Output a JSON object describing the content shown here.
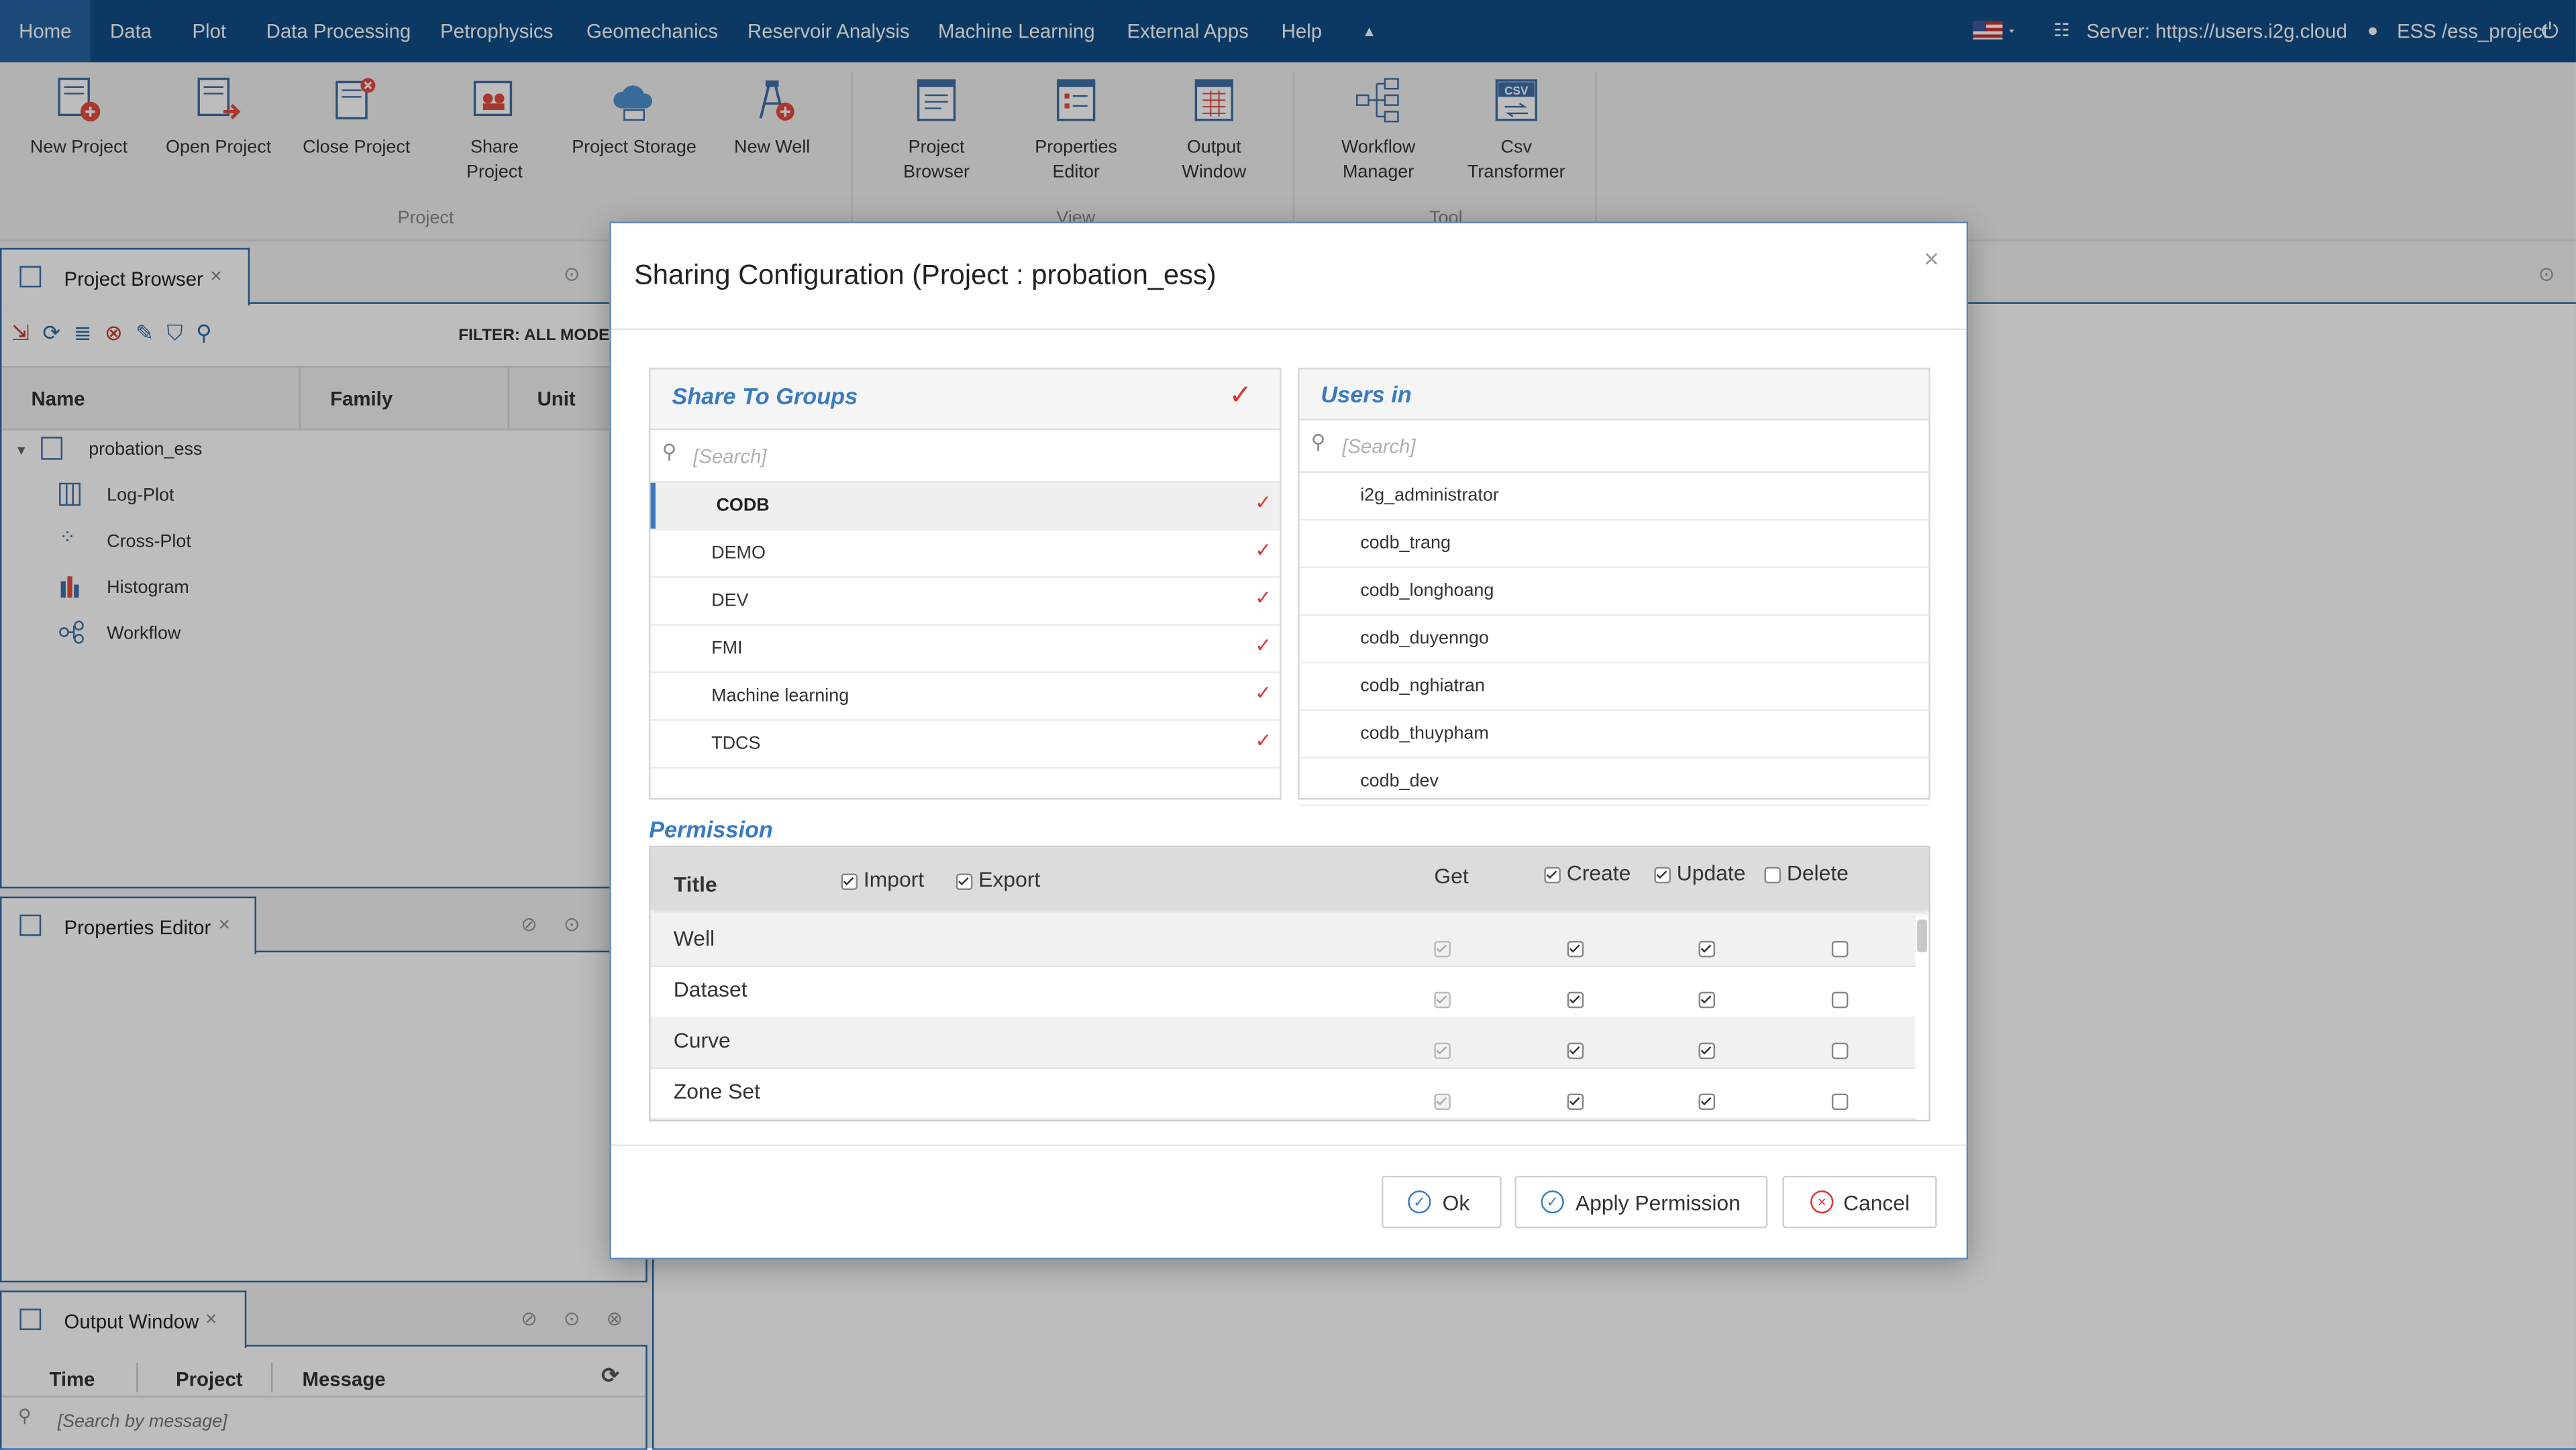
{
  "menu": {
    "items": [
      "Home",
      "Data",
      "Plot",
      "Data Processing",
      "Petrophysics",
      "Geomechanics",
      "Reservoir Analysis",
      "Machine Learning",
      "External Apps",
      "Help"
    ],
    "server": "Server: https://users.i2g.cloud",
    "user": "ESS /ess_project"
  },
  "ribbon": {
    "buttons": [
      "New Project",
      "Open Project",
      "Close Project",
      "Share Project",
      "Project Storage",
      "New Well",
      "Project\nBrowser",
      "Properties\nEditor",
      "Output\nWindow",
      "Workflow\nManager",
      "Csv\nTransformer"
    ],
    "group_project": "Project",
    "group_view": "View",
    "group_tool": "Tool"
  },
  "project_browser": {
    "tab": "Project Browser",
    "filter": "FILTER: ALL MODE",
    "columns": [
      "Name",
      "Family",
      "Unit"
    ],
    "root": "probation_ess",
    "items": [
      "Log-Plot",
      "Cross-Plot",
      "Histogram",
      "Workflow"
    ]
  },
  "properties_editor": {
    "tab": "Properties Editor"
  },
  "output_window": {
    "tab": "Output Window",
    "columns": [
      "Time",
      "Project",
      "Message"
    ],
    "search_placeholder": "[Search by message]"
  },
  "dialog": {
    "title": "Sharing Configuration (Project : probation_ess)",
    "close": "×",
    "groups": {
      "title": "Share To Groups",
      "search_placeholder": "[Search]",
      "items": [
        "CODB",
        "DEMO",
        "DEV",
        "FMI",
        "Machine learning",
        "TDCS"
      ],
      "selected": "CODB"
    },
    "users": {
      "title": "Users in",
      "search_placeholder": "[Search]",
      "items": [
        "i2g_administrator",
        "codb_trang",
        "codb_longhoang",
        "codb_duyenngo",
        "codb_nghiatran",
        "codb_thuypham",
        "codb_dev"
      ]
    },
    "permission": {
      "label": "Permission",
      "header": {
        "title": "Title",
        "import": "Import",
        "export": "Export",
        "get": "Get",
        "create": "Create",
        "update": "Update",
        "delete": "Delete"
      },
      "rows": [
        {
          "title": "Well",
          "get": true,
          "create": true,
          "update": true,
          "delete": false
        },
        {
          "title": "Dataset",
          "get": true,
          "create": true,
          "update": true,
          "delete": false
        },
        {
          "title": "Curve",
          "get": true,
          "create": true,
          "update": true,
          "delete": false
        },
        {
          "title": "Zone Set",
          "get": true,
          "create": true,
          "update": true,
          "delete": false
        }
      ]
    },
    "buttons": {
      "ok": "Ok",
      "apply": "Apply Permission",
      "cancel": "Cancel"
    }
  },
  "colors": {
    "menubar": "#114e86",
    "accent": "#3a7bbf",
    "check": "#e03030"
  }
}
